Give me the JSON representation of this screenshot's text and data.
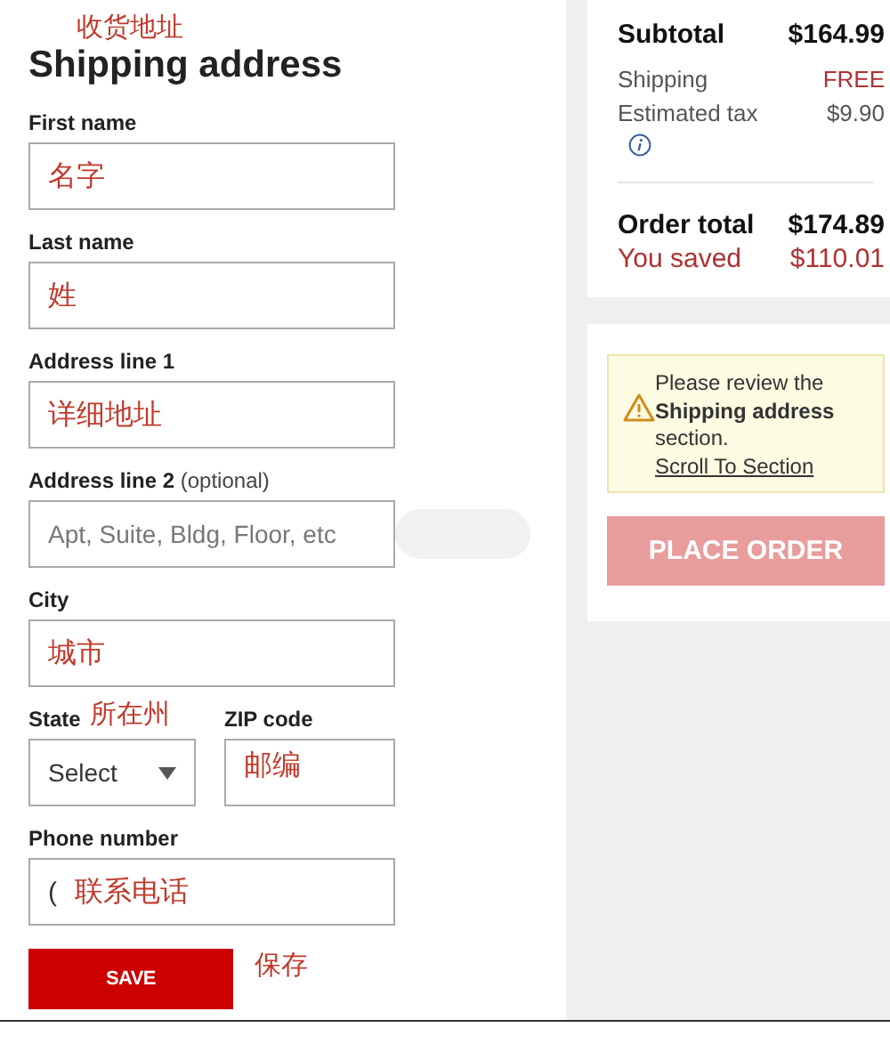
{
  "form": {
    "annotation": "收货地址",
    "title": "Shipping address",
    "fields": [
      {
        "label": "First name",
        "note": "名字"
      },
      {
        "label": "Last name",
        "note": "姓"
      },
      {
        "label": "Address line 1",
        "note": "详细地址"
      },
      {
        "label": "Address line 2",
        "label_hint": "(optional)",
        "placeholder": "Apt, Suite, Bldg, Floor, etc"
      },
      {
        "label": "City",
        "note": "城市"
      }
    ],
    "state": {
      "label": "State",
      "label_note": "所在州",
      "value": "Select"
    },
    "zip": {
      "label": "ZIP code",
      "note": "邮编"
    },
    "phone": {
      "label": "Phone number",
      "value": "(",
      "note": "联系电话"
    },
    "save": {
      "label": "SAVE",
      "note": "保存"
    }
  },
  "summary": {
    "rows": [
      {
        "kind": "subtotal",
        "label": "Subtotal",
        "value": "$164.99"
      },
      {
        "kind": "highlight",
        "label": "Shipping",
        "value": "FREE"
      },
      {
        "kind": "plain",
        "label": "Estimated tax",
        "value": "$9.90",
        "info": true
      }
    ],
    "totals": [
      {
        "kind": "total",
        "label": "Order total",
        "value": "$174.89"
      },
      {
        "kind": "savings",
        "label": "You saved",
        "value": "$110.01"
      }
    ]
  },
  "notice": {
    "text": "Please review the **Shipping address** section.",
    "link": "Scroll To Section"
  },
  "place_order": {
    "label": "PLACE ORDER",
    "disabled": true
  }
}
